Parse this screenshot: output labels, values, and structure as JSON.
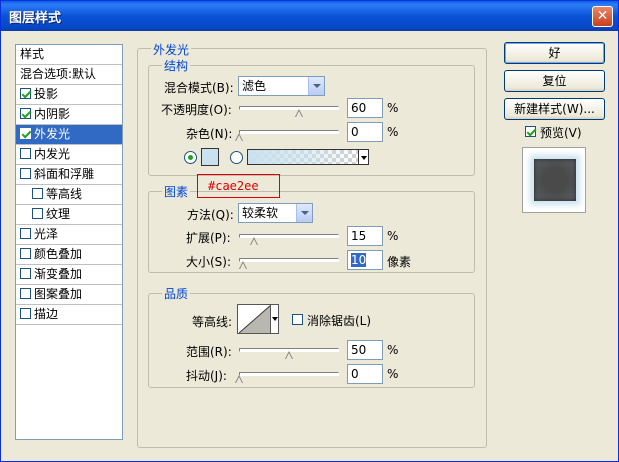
{
  "window": {
    "title": "图层样式",
    "close": "✕"
  },
  "style_list": {
    "header": "样式",
    "items": [
      {
        "label": "混合选项:默认",
        "checkbox": false
      },
      {
        "label": "投影",
        "checkbox": true,
        "checked": true
      },
      {
        "label": "内阴影",
        "checkbox": true,
        "checked": true
      },
      {
        "label": "外发光",
        "checkbox": true,
        "checked": true,
        "selected": true
      },
      {
        "label": "内发光",
        "checkbox": true,
        "checked": false
      },
      {
        "label": "斜面和浮雕",
        "checkbox": true,
        "checked": false
      },
      {
        "label": "等高线",
        "checkbox": true,
        "checked": false,
        "indent": true
      },
      {
        "label": "纹理",
        "checkbox": true,
        "checked": false,
        "indent": true
      },
      {
        "label": "光泽",
        "checkbox": true,
        "checked": false
      },
      {
        "label": "颜色叠加",
        "checkbox": true,
        "checked": false
      },
      {
        "label": "渐变叠加",
        "checkbox": true,
        "checked": false
      },
      {
        "label": "图案叠加",
        "checkbox": true,
        "checked": false
      },
      {
        "label": "描边",
        "checkbox": true,
        "checked": false
      }
    ]
  },
  "outer_glow": {
    "title": "外发光",
    "structure": {
      "title": "结构",
      "blend_mode_label": "混合模式(B):",
      "blend_mode_value": "滤色",
      "opacity_label": "不透明度(O):",
      "opacity_value": "60",
      "opacity_unit": "%",
      "opacity_level": 0.6,
      "noise_label": "杂色(N):",
      "noise_value": "0",
      "noise_unit": "%",
      "noise_level": 0.0,
      "color_swatch": "#cae2ee"
    },
    "elements": {
      "title": "图素",
      "method_label": "方法(Q):",
      "method_value": "较柔软",
      "spread_label": "扩展(P):",
      "spread_value": "15",
      "spread_unit": "%",
      "spread_level": 0.15,
      "size_label": "大小(S):",
      "size_value": "10",
      "size_unit": "像素",
      "size_level": 0.04
    },
    "quality": {
      "title": "品质",
      "contour_label": "等高线:",
      "antialias_label": "消除锯齿(L)",
      "range_label": "范围(R):",
      "range_value": "50",
      "range_unit": "%",
      "range_level": 0.5,
      "jitter_label": "抖动(J):",
      "jitter_value": "0",
      "jitter_unit": "%",
      "jitter_level": 0.0
    }
  },
  "annotation": "#cae2ee",
  "buttons": {
    "ok": "好",
    "reset": "复位",
    "new_style": "新建样式(W)...",
    "preview_label": "预览(V)"
  },
  "colors": {
    "glow_color": "#cae2ee",
    "selection": "#316ac5",
    "annotation": "#dd0000"
  }
}
